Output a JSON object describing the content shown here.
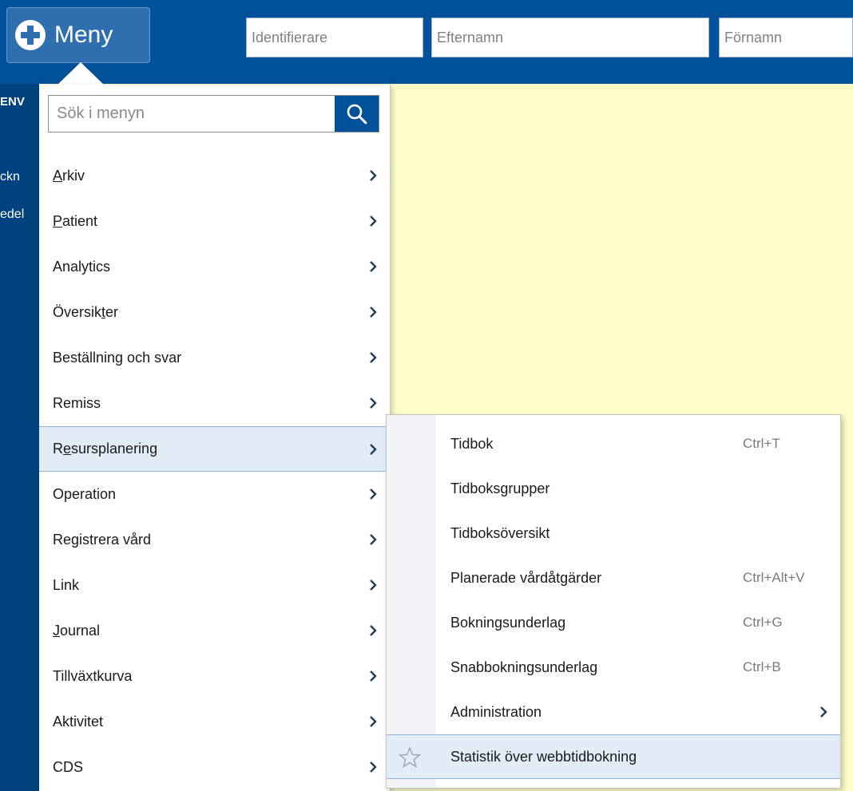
{
  "header": {
    "menu_button_label": "Meny",
    "identifier_placeholder": "Identifierare",
    "lastname_placeholder": "Efternamn",
    "firstname_placeholder": "Förnamn"
  },
  "left_panel": {
    "fragments": [
      "ENV",
      "ckn",
      "edel"
    ]
  },
  "menu": {
    "search_placeholder": "Sök i menyn",
    "search_icon": "search-icon",
    "items": [
      {
        "label": "Arkiv",
        "accel": "A",
        "has_submenu": true
      },
      {
        "label": "Patient",
        "accel": "P",
        "has_submenu": true
      },
      {
        "label": "Analytics",
        "has_submenu": true
      },
      {
        "label": "Översikter",
        "accel": "t",
        "has_submenu": true
      },
      {
        "label": "Beställning och svar",
        "has_submenu": true
      },
      {
        "label": "Remiss",
        "has_submenu": true
      },
      {
        "label": "Resursplanering",
        "accel": "e",
        "has_submenu": true,
        "active": true
      },
      {
        "label": "Operation",
        "has_submenu": true
      },
      {
        "label": "Registrera vård",
        "has_submenu": true
      },
      {
        "label": "Link",
        "has_submenu": true
      },
      {
        "label": "Journal",
        "accel": "J",
        "has_submenu": true
      },
      {
        "label": "Tillväxtkurva",
        "has_submenu": true
      },
      {
        "label": "Aktivitet",
        "has_submenu": true
      },
      {
        "label": "CDS",
        "has_submenu": true
      }
    ]
  },
  "submenu": {
    "items": [
      {
        "label": "Tidbok",
        "shortcut": "Ctrl+T"
      },
      {
        "label": "Tidboksgrupper",
        "shortcut": ""
      },
      {
        "label": "Tidboksöversikt",
        "shortcut": ""
      },
      {
        "label": "Planerade vårdåtgärder",
        "shortcut": "Ctrl+Alt+V"
      },
      {
        "label": "Bokningsunderlag",
        "shortcut": "Ctrl+G"
      },
      {
        "label": "Snabbokningsunderlag",
        "shortcut": "Ctrl+B"
      },
      {
        "label": "Administration",
        "shortcut": "",
        "has_submenu": true
      },
      {
        "label": "Statistik över webbtidbokning",
        "shortcut": "",
        "highlighted": true,
        "icon": "star-icon"
      }
    ]
  },
  "colors": {
    "header_bg": "#00509a",
    "left_panel_bg": "#00427f",
    "content_bg": "#ffffc8",
    "active_row_bg": "#e1ecf7"
  }
}
